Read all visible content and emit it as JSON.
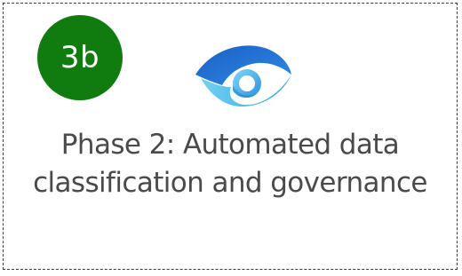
{
  "card": {
    "badge_label": "3b",
    "badge_color": "#107c10",
    "icon": "eye-icon",
    "text_lines": [
      "Phase 2: Automated data",
      "classification and governance"
    ]
  },
  "colors": {
    "text": "#4a4a4a",
    "border": "#3a3a3a",
    "icon_blue_dark": "#1f6fd1",
    "icon_blue_light": "#5bc0eb"
  }
}
